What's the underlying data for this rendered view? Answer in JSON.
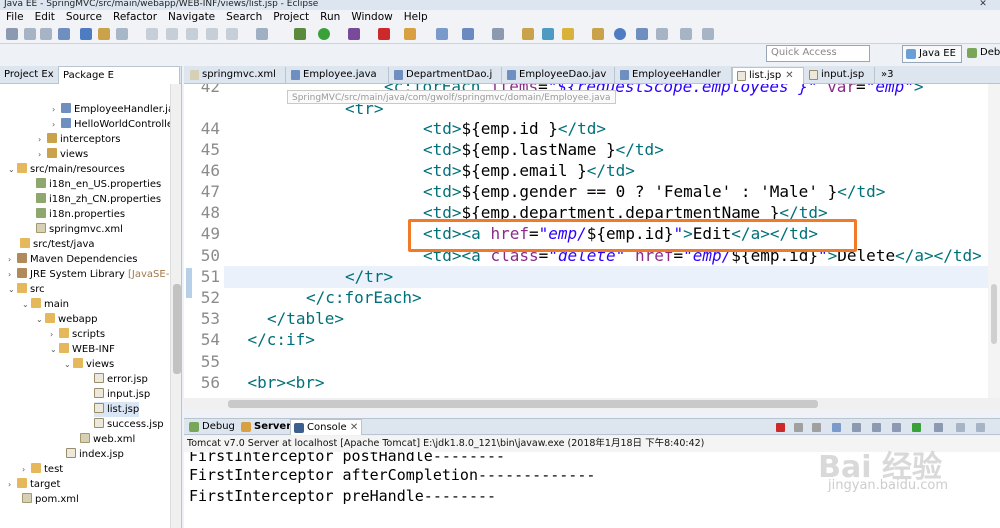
{
  "window": {
    "title": "Java EE - SpringMVC/src/main/webapp/WEB-INF/views/list.jsp - Eclipse",
    "close": "✕"
  },
  "menu": [
    "File",
    "Edit",
    "Source",
    "Refactor",
    "Navigate",
    "Search",
    "Project",
    "Run",
    "Window",
    "Help"
  ],
  "quick_access": {
    "placeholder": "Quick Access"
  },
  "perspectives": {
    "active": "Java EE",
    "other": "Deb"
  },
  "explorer": {
    "tabs": [
      "Project Ex",
      "Package E"
    ],
    "items": [
      {
        "label": "EmployeeHandler.ja",
        "icon": "java"
      },
      {
        "label": "HelloWorldControlle",
        "icon": "java"
      },
      {
        "label": "interceptors",
        "icon": "pkg"
      },
      {
        "label": "views",
        "icon": "pkg"
      },
      {
        "label": "src/main/resources",
        "icon": "folder"
      },
      {
        "label": "i18n_en_US.properties",
        "icon": "prop"
      },
      {
        "label": "i18n_zh_CN.properties",
        "icon": "prop"
      },
      {
        "label": "i18n.properties",
        "icon": "prop"
      },
      {
        "label": "springmvc.xml",
        "icon": "xml"
      },
      {
        "label": "src/test/java",
        "icon": "folder"
      },
      {
        "label": "Maven Dependencies",
        "icon": "lib"
      },
      {
        "label": "JRE System Library",
        "suffix": "[JavaSE-1.",
        "icon": "lib"
      },
      {
        "label": "src",
        "icon": "folder"
      },
      {
        "label": "main",
        "icon": "folder"
      },
      {
        "label": "webapp",
        "icon": "folder"
      },
      {
        "label": "scripts",
        "icon": "folder"
      },
      {
        "label": "WEB-INF",
        "icon": "folder"
      },
      {
        "label": "views",
        "icon": "folder"
      },
      {
        "label": "error.jsp",
        "icon": "jsp"
      },
      {
        "label": "input.jsp",
        "icon": "jsp"
      },
      {
        "label": "list.jsp",
        "icon": "jsp"
      },
      {
        "label": "success.jsp",
        "icon": "jsp"
      },
      {
        "label": "web.xml",
        "icon": "xml"
      },
      {
        "label": "index.jsp",
        "icon": "jsp"
      },
      {
        "label": "test",
        "icon": "folder"
      },
      {
        "label": "target",
        "icon": "folder"
      },
      {
        "label": "pom.xml",
        "icon": "xml"
      }
    ]
  },
  "editor": {
    "tabs": [
      "springmvc.xml",
      "Employee.java",
      "DepartmentDao.j",
      "EmployeeDao.jav",
      "EmployeeHandler",
      "list.jsp",
      "input.jsp"
    ],
    "overflow": "»3",
    "hover_path": "SpringMVC/src/main/java/com/gwolf/springmvc/domain/Employee.java",
    "lines": [
      {
        "num": "42",
        "parts": [
          [
            "t",
            "<c:forEach "
          ],
          [
            "a",
            "items"
          ],
          [
            "p",
            "="
          ],
          [
            "s",
            "\"${requestScope.employees }\""
          ],
          [
            "p",
            " "
          ],
          [
            "a",
            "var"
          ],
          [
            "p",
            "="
          ],
          [
            "s",
            "\"emp\""
          ],
          [
            "t",
            ">"
          ]
        ]
      },
      {
        "num": "",
        "parts": [
          [
            "t",
            "<tr>"
          ]
        ]
      },
      {
        "num": "44",
        "parts": [
          [
            "t",
            "<td>"
          ],
          [
            "p",
            "${emp.id }"
          ],
          [
            "t",
            "</td>"
          ]
        ]
      },
      {
        "num": "45",
        "parts": [
          [
            "t",
            "<td>"
          ],
          [
            "p",
            "${emp.lastName }"
          ],
          [
            "t",
            "</td>"
          ]
        ]
      },
      {
        "num": "46",
        "parts": [
          [
            "t",
            "<td>"
          ],
          [
            "p",
            "${emp.email }"
          ],
          [
            "t",
            "</td>"
          ]
        ]
      },
      {
        "num": "47",
        "parts": [
          [
            "t",
            "<td>"
          ],
          [
            "p",
            "${emp.gender == 0 ? 'Female' : 'Male' }"
          ],
          [
            "t",
            "</td>"
          ]
        ]
      },
      {
        "num": "48",
        "parts": [
          [
            "t",
            "<td>"
          ],
          [
            "p",
            "${emp.department.departmentName }"
          ],
          [
            "t",
            "</td>"
          ]
        ]
      },
      {
        "num": "49",
        "parts": [
          [
            "t",
            "<td><a "
          ],
          [
            "a",
            "href"
          ],
          [
            "p",
            "="
          ],
          [
            "s",
            "\"emp/"
          ],
          [
            "p",
            "${emp.id}"
          ],
          [
            "s",
            "\""
          ],
          [
            "t",
            ">"
          ],
          [
            "p",
            "Edit"
          ],
          [
            "t",
            "</a></td>"
          ]
        ]
      },
      {
        "num": "50",
        "parts": [
          [
            "t",
            "<td><a "
          ],
          [
            "a",
            "class"
          ],
          [
            "p",
            "="
          ],
          [
            "s",
            "\"delete\""
          ],
          [
            "p",
            " "
          ],
          [
            "a",
            "href"
          ],
          [
            "p",
            "="
          ],
          [
            "s",
            "\"emp/"
          ],
          [
            "p",
            "${emp.id}"
          ],
          [
            "s",
            "\""
          ],
          [
            "t",
            ">"
          ],
          [
            "p",
            "Delete"
          ],
          [
            "t",
            "</a></td>"
          ]
        ]
      },
      {
        "num": "51",
        "parts": [
          [
            "t",
            "</tr>"
          ]
        ]
      },
      {
        "num": "52",
        "parts": [
          [
            "t",
            "</c:forEach>"
          ]
        ]
      },
      {
        "num": "53",
        "parts": [
          [
            "t",
            "</table>"
          ]
        ]
      },
      {
        "num": "54",
        "parts": [
          [
            "t",
            "</c:if>"
          ]
        ]
      },
      {
        "num": "55",
        "parts": []
      },
      {
        "num": "56",
        "parts": [
          [
            "t",
            "<br><br>"
          ]
        ]
      }
    ]
  },
  "console": {
    "tabs": [
      "Debug",
      "Servers",
      "Console"
    ],
    "status": "Tomcat v7.0 Server at localhost [Apache Tomcat] E:\\jdk1.8.0_121\\bin\\javaw.exe (2018年1月18日 下午8:40:42)",
    "lines": [
      "FirstInterceptor postHandle--------",
      "FirstInterceptor afterCompletion-------------",
      "FirstInterceptor preHandle--------"
    ]
  },
  "watermark": {
    "brand": "Bai 经验",
    "url": "jingyan.baidu.com"
  },
  "colors": {
    "highlight_box": "#f07a28",
    "tag": "#00707a",
    "attribute": "#8a2b8a",
    "string": "#2a00ff"
  }
}
